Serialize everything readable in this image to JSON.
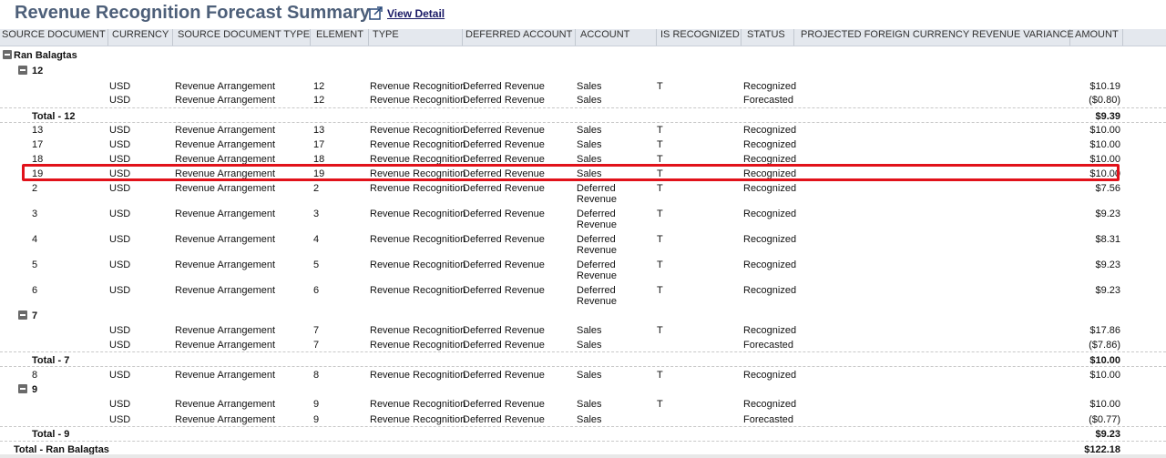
{
  "title": "Revenue Recognition Forecast Summary",
  "view_detail": "View Detail",
  "columns": [
    "SOURCE DOCUMENT",
    "CURRENCY",
    "SOURCE DOCUMENT TYPE",
    "ELEMENT",
    "TYPE",
    "DEFERRED ACCOUNT",
    "ACCOUNT",
    "IS RECOGNIZED",
    "STATUS",
    "PROJECTED FOREIGN CURRENCY REVENUE VARIANCE",
    "AMOUNT"
  ],
  "group": "Ran Balagtas",
  "rows": {
    "sub12": "12",
    "r12a": {
      "cur": "USD",
      "sdt": "Revenue Arrangement",
      "el": "12",
      "type": "Revenue Recognition",
      "def": "Deferred Revenue",
      "acct": "Sales",
      "rec": "T",
      "status": "Recognized",
      "amt": "$10.19"
    },
    "r12b": {
      "cur": "USD",
      "sdt": "Revenue Arrangement",
      "el": "12",
      "type": "Revenue Recognition",
      "def": "Deferred Revenue",
      "acct": "Sales",
      "rec": "",
      "status": "Forecasted",
      "amt": "($0.80)"
    },
    "tot12": {
      "label": "Total - 12",
      "amt": "$9.39"
    },
    "r13": {
      "doc": "13",
      "cur": "USD",
      "sdt": "Revenue Arrangement",
      "el": "13",
      "type": "Revenue Recognition",
      "def": "Deferred Revenue",
      "acct": "Sales",
      "rec": "T",
      "status": "Recognized",
      "amt": "$10.00"
    },
    "r17": {
      "doc": "17",
      "cur": "USD",
      "sdt": "Revenue Arrangement",
      "el": "17",
      "type": "Revenue Recognition",
      "def": "Deferred Revenue",
      "acct": "Sales",
      "rec": "T",
      "status": "Recognized",
      "amt": "$10.00"
    },
    "r18": {
      "doc": "18",
      "cur": "USD",
      "sdt": "Revenue Arrangement",
      "el": "18",
      "type": "Revenue Recognition",
      "def": "Deferred Revenue",
      "acct": "Sales",
      "rec": "T",
      "status": "Recognized",
      "amt": "$10.00"
    },
    "r19": {
      "doc": "19",
      "cur": "USD",
      "sdt": "Revenue Arrangement",
      "el": "19",
      "type": "Revenue Recognition",
      "def": "Deferred Revenue",
      "acct": "Sales",
      "rec": "T",
      "status": "Recognized",
      "amt": "$10.00"
    },
    "r2": {
      "doc": "2",
      "cur": "USD",
      "sdt": "Revenue Arrangement",
      "el": "2",
      "type": "Revenue Recognition",
      "def": "Deferred Revenue",
      "acct": "Deferred Revenue",
      "rec": "T",
      "status": "Recognized",
      "amt": "$7.56"
    },
    "r3": {
      "doc": "3",
      "cur": "USD",
      "sdt": "Revenue Arrangement",
      "el": "3",
      "type": "Revenue Recognition",
      "def": "Deferred Revenue",
      "acct": "Deferred Revenue",
      "rec": "T",
      "status": "Recognized",
      "amt": "$9.23"
    },
    "r4": {
      "doc": "4",
      "cur": "USD",
      "sdt": "Revenue Arrangement",
      "el": "4",
      "type": "Revenue Recognition",
      "def": "Deferred Revenue",
      "acct": "Deferred Revenue",
      "rec": "T",
      "status": "Recognized",
      "amt": "$8.31"
    },
    "r5": {
      "doc": "5",
      "cur": "USD",
      "sdt": "Revenue Arrangement",
      "el": "5",
      "type": "Revenue Recognition",
      "def": "Deferred Revenue",
      "acct": "Deferred Revenue",
      "rec": "T",
      "status": "Recognized",
      "amt": "$9.23"
    },
    "r6": {
      "doc": "6",
      "cur": "USD",
      "sdt": "Revenue Arrangement",
      "el": "6",
      "type": "Revenue Recognition",
      "def": "Deferred Revenue",
      "acct": "Deferred Revenue",
      "rec": "T",
      "status": "Recognized",
      "amt": "$9.23"
    },
    "sub7": "7",
    "r7a": {
      "cur": "USD",
      "sdt": "Revenue Arrangement",
      "el": "7",
      "type": "Revenue Recognition",
      "def": "Deferred Revenue",
      "acct": "Sales",
      "rec": "T",
      "status": "Recognized",
      "amt": "$17.86"
    },
    "r7b": {
      "cur": "USD",
      "sdt": "Revenue Arrangement",
      "el": "7",
      "type": "Revenue Recognition",
      "def": "Deferred Revenue",
      "acct": "Sales",
      "rec": "",
      "status": "Forecasted",
      "amt": "($7.86)"
    },
    "tot7": {
      "label": "Total - 7",
      "amt": "$10.00"
    },
    "r8": {
      "doc": "8",
      "cur": "USD",
      "sdt": "Revenue Arrangement",
      "el": "8",
      "type": "Revenue Recognition",
      "def": "Deferred Revenue",
      "acct": "Sales",
      "rec": "T",
      "status": "Recognized",
      "amt": "$10.00"
    },
    "sub9": "9",
    "r9a": {
      "cur": "USD",
      "sdt": "Revenue Arrangement",
      "el": "9",
      "type": "Revenue Recognition",
      "def": "Deferred Revenue",
      "acct": "Sales",
      "rec": "T",
      "status": "Recognized",
      "amt": "$10.00"
    },
    "r9b": {
      "cur": "USD",
      "sdt": "Revenue Arrangement",
      "el": "9",
      "type": "Revenue Recognition",
      "def": "Deferred Revenue",
      "acct": "Sales",
      "rec": "",
      "status": "Forecasted",
      "amt": "($0.77)"
    },
    "tot9": {
      "label": "Total - 9",
      "amt": "$9.23"
    },
    "grand": {
      "label": "Total - Ran Balagtas",
      "amt": "$122.18"
    }
  },
  "colors": {
    "title": "#4d5f79",
    "header_bg": "#e4e8ee",
    "highlight": "#e1121a"
  },
  "icons": {
    "view_detail": "report-link-icon",
    "toggle": "collapse-minus-icon"
  }
}
